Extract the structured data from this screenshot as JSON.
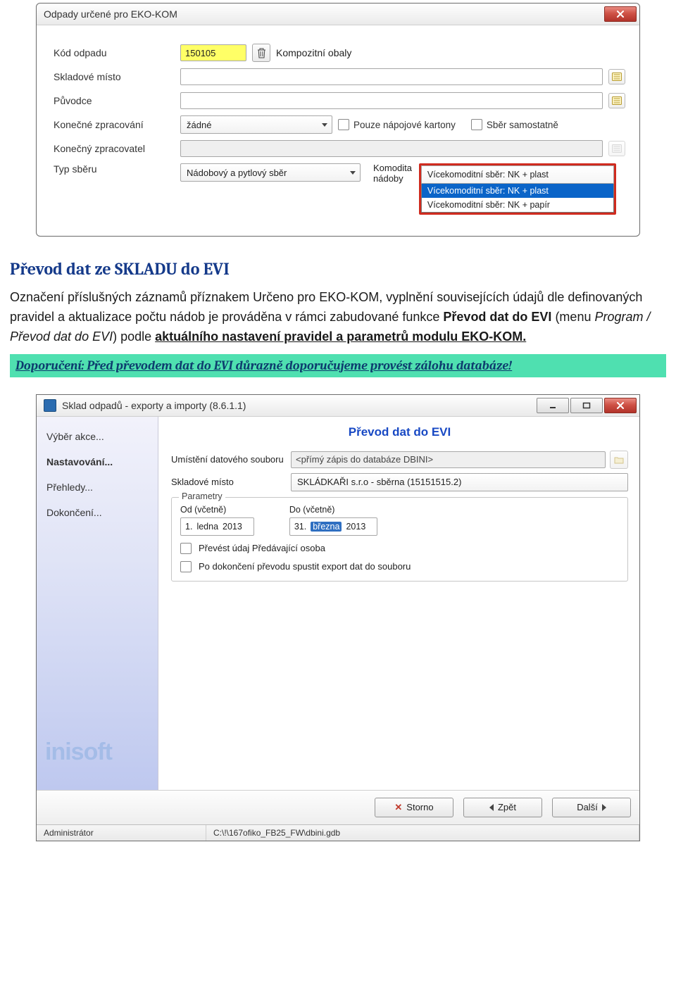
{
  "dialog1": {
    "title": "Odpady určené pro EKO-KOM",
    "labels": {
      "kod": "Kód odpadu",
      "sklad_misto": "Skladové místo",
      "puvodce": "Původce",
      "konecne_zprac": "Konečné zpracování",
      "konecny_zpracovatel": "Konečný zpracovatel",
      "typ_sberu": "Typ sběru",
      "komodita_line1": "Komodita",
      "komodita_line2": "nádoby",
      "chk_kartony": "Pouze nápojové kartony",
      "chk_samostatne": "Sběr samostatně"
    },
    "values": {
      "kod": "150105",
      "kod_desc": "Kompozitní obaly",
      "konecne_zprac": "žádné",
      "typ_sberu": "Nádobový a pytlový sběr",
      "komodita_selected": "Vícekomoditní sběr: NK + plast",
      "komodita_options": [
        "Vícekomoditní sběr: NK + plast",
        "Vícekomoditní sběr: NK + papír"
      ]
    }
  },
  "section": {
    "heading": "Převod dat ze SKLADU do EVI",
    "para_plain1": "Označení příslušných záznamů příznakem Určeno pro EKO-KOM, vyplnění souvisejících údajů dle definovaných pravidel a aktualizace počtu nádob je prováděna v rámci zabudované funkce ",
    "para_bold1": "Převod dat do EVI",
    "para_plain2": " (menu ",
    "para_italic": "Program / Převod dat do EVI",
    "para_plain3": ") podle ",
    "para_underline": "aktuálního nastavení pravidel a parametrů modulu EKO-KOM.",
    "tip": "Doporučení: Před převodem dat do EVI důrazně doporučujeme provést zálohu databáze!"
  },
  "dialog2": {
    "title": "Sklad odpadů - exporty a importy (8.6.1.1)",
    "steps": [
      "Výběr akce...",
      "Nastavování...",
      "Přehledy...",
      "Dokončení..."
    ],
    "active_step_index": 1,
    "page_title": "Převod dat do EVI",
    "labels": {
      "umisteni": "Umístění datového souboru",
      "sklad_misto": "Skladové místo",
      "fieldset": "Parametry",
      "od": "Od (včetně)",
      "do": "Do (včetně)",
      "chk_prevest": "Převést údaj Předávající osoba",
      "chk_po_dokonceni": "Po dokončení převodu spustit export dat do souboru"
    },
    "values": {
      "umisteni": "<přímý zápis do databáze DBINI>",
      "sklad_misto": "SKLÁDKAŘI s.r.o - sběrna (15151515.2)",
      "date_from_day": "1.",
      "date_from_month": "ledna",
      "date_from_year": "2013",
      "date_to_day": "31.",
      "date_to_month": "března",
      "date_to_year": "2013"
    },
    "buttons": {
      "storno": "Storno",
      "zpet": "Zpět",
      "dalsi": "Další"
    },
    "status": {
      "user": "Administrátor",
      "path": "C:\\!\\167ofiko_FB25_FW\\dbini.gdb"
    },
    "logo": "inisoft"
  }
}
